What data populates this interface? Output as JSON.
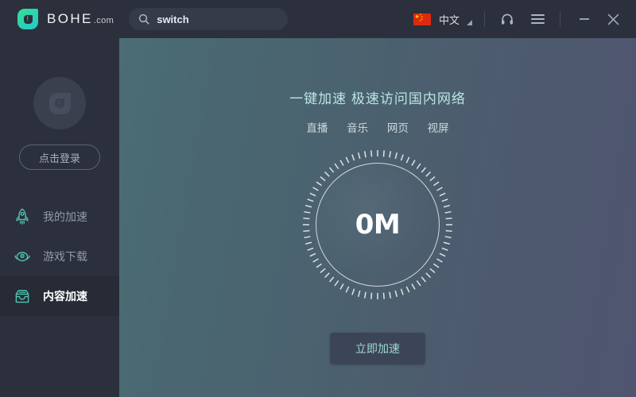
{
  "titlebar": {
    "brand_name": "BOHE",
    "brand_suffix": ".com",
    "logo_icon": "bohe-shield-icon",
    "search": {
      "icon": "search-icon",
      "value": "switch",
      "placeholder": "switch"
    },
    "language": {
      "flag_icon": "china-flag-icon",
      "label": "中文",
      "caret_icon": "dropdown-caret-icon"
    },
    "support_icon": "headset-icon",
    "menu_icon": "hamburger-menu-icon",
    "minimize_icon": "minimize-icon",
    "close_icon": "close-icon"
  },
  "sidebar": {
    "avatar_icon": "avatar-placeholder-icon",
    "login_label": "点击登录",
    "items": [
      {
        "label": "我的加速",
        "icon": "rocket-icon",
        "active": false
      },
      {
        "label": "游戏下载",
        "icon": "game-controller-icon",
        "active": false
      },
      {
        "label": "内容加速",
        "icon": "inbox-tray-icon",
        "active": true
      }
    ]
  },
  "main": {
    "title": "一键加速 极速访问国内网络",
    "tags": [
      "直播",
      "音乐",
      "网页",
      "视屏"
    ],
    "gauge": {
      "value": "0M",
      "tick_count": 72
    },
    "cta_label": "立即加速"
  },
  "colors": {
    "accent_teal": "#3ddc97",
    "sidebar_bg": "#2b303c",
    "active_item_bg": "#262b36",
    "main_gradient_start": "#4b6d75",
    "main_gradient_end": "#4f5570",
    "cta_text": "#9ddad3",
    "title_text": "#b9e6e2"
  }
}
